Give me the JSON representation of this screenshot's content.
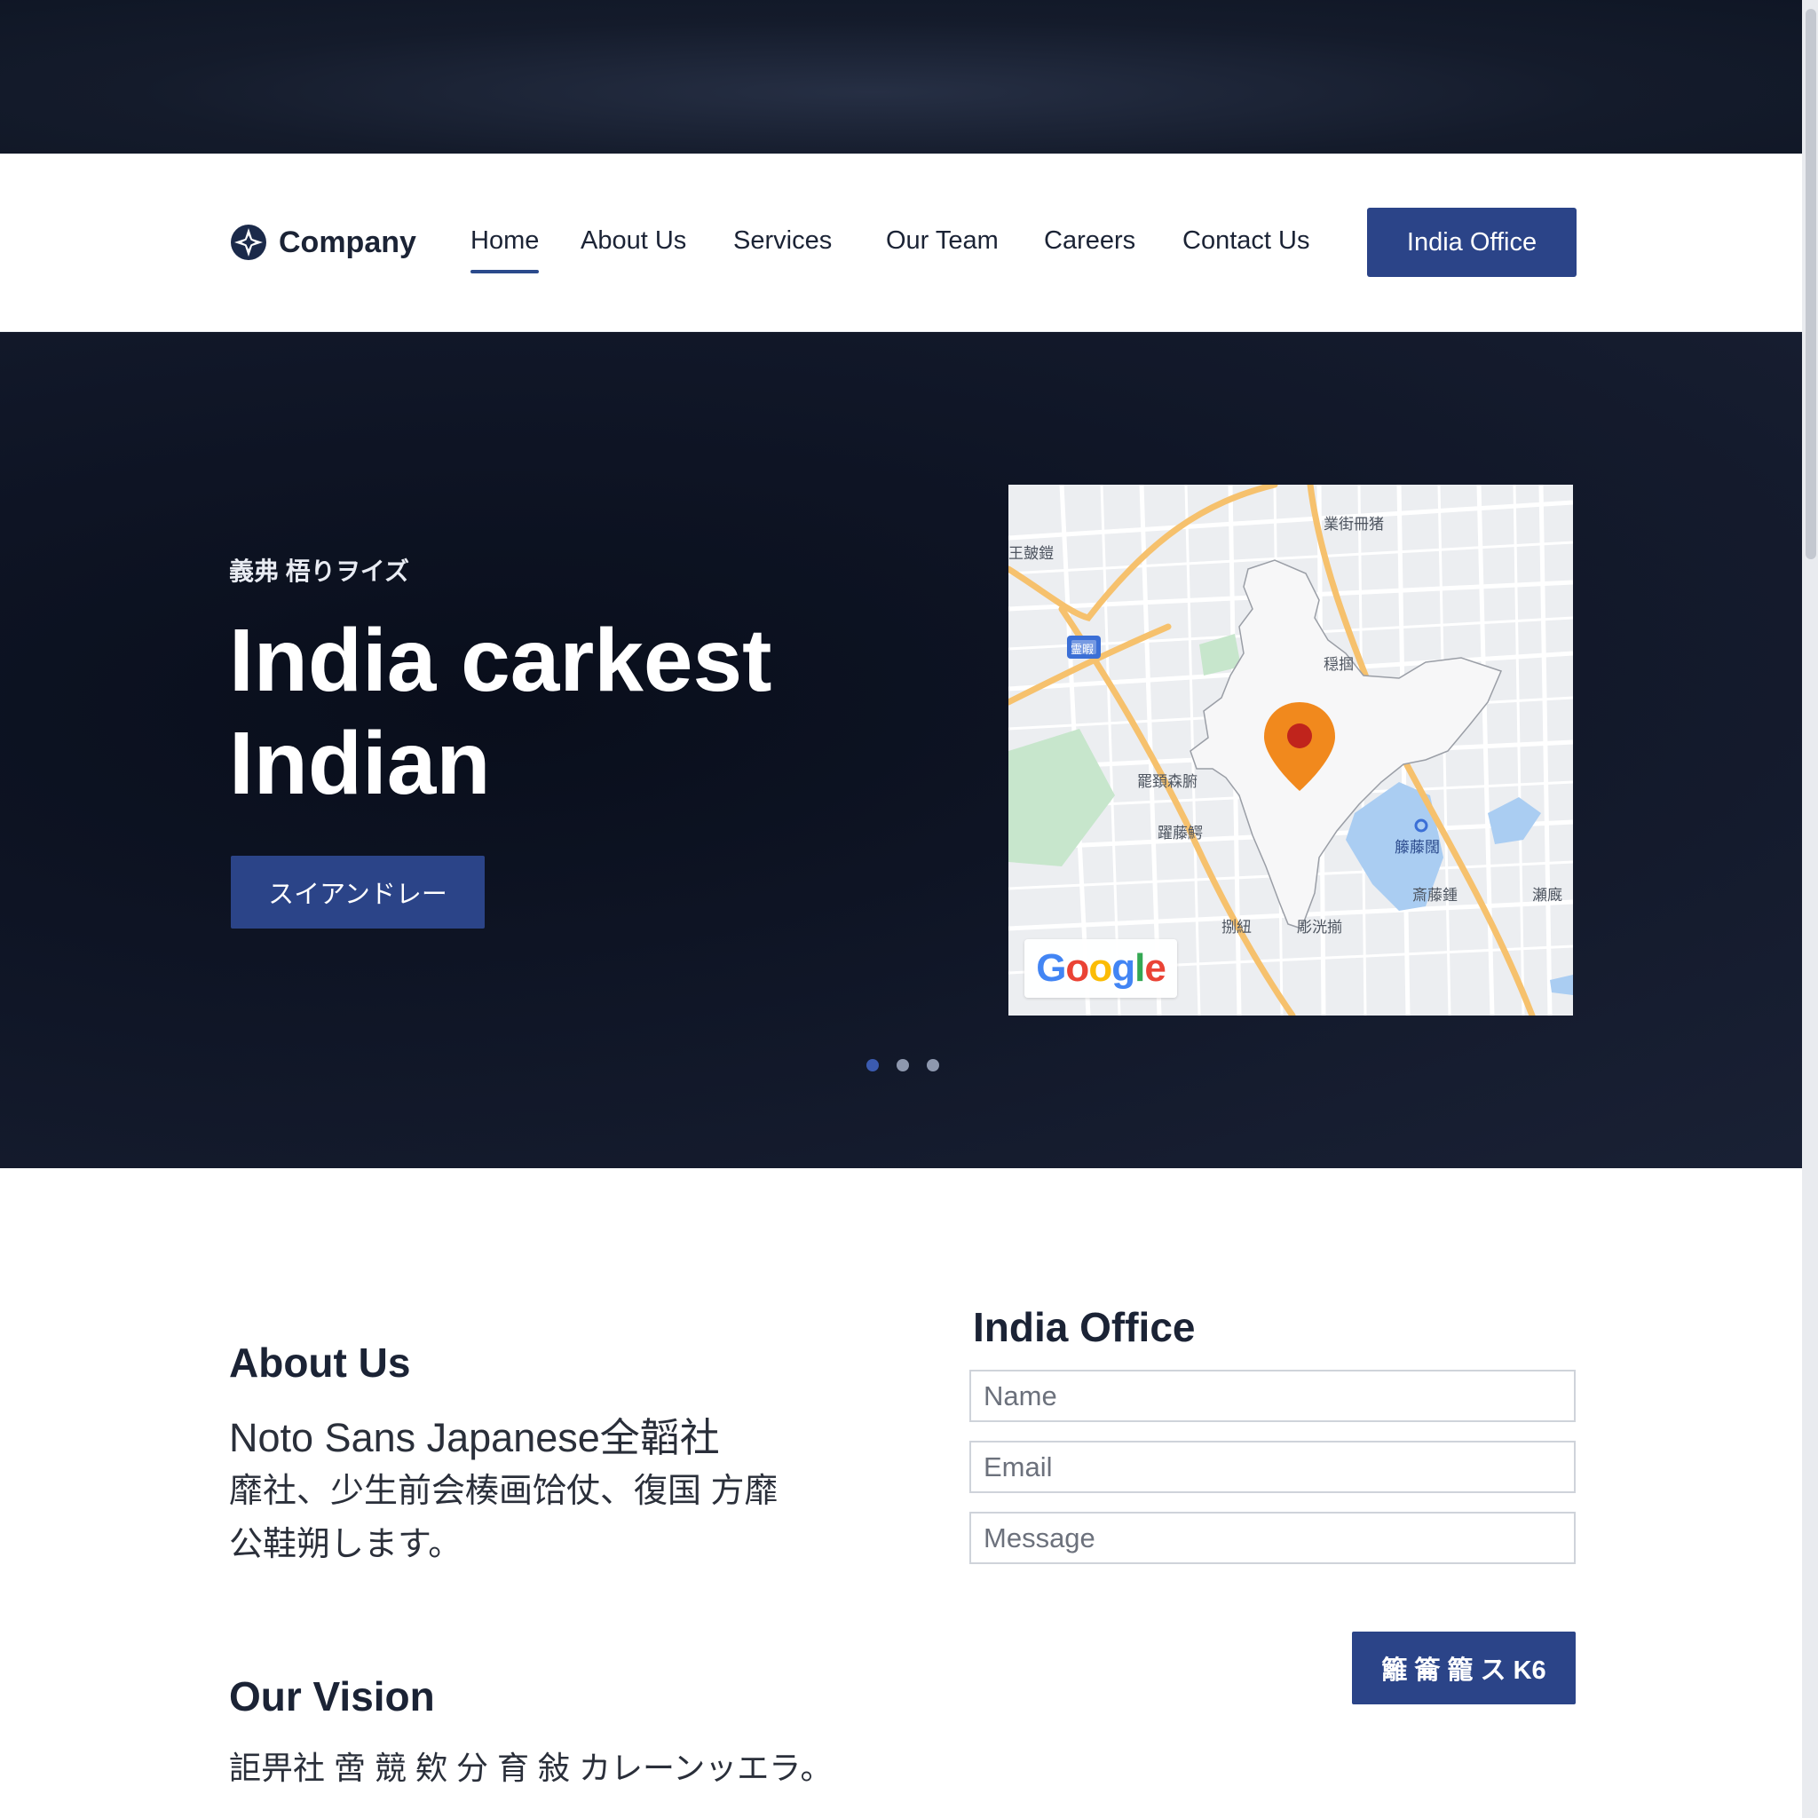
{
  "colors": {
    "accent": "#2b4488",
    "dark_bg": "#141b2b",
    "text": "#1b2335"
  },
  "header": {
    "logo_text": "Company",
    "logo_icon": "compass-star-icon",
    "nav": [
      {
        "label": "Home",
        "active": true
      },
      {
        "label": "About Us",
        "active": false
      },
      {
        "label": "Services",
        "active": false
      },
      {
        "label": "Our Team",
        "active": false
      },
      {
        "label": "Careers",
        "active": false
      },
      {
        "label": "Contact Us",
        "active": false
      }
    ],
    "cta_label": "India Office"
  },
  "hero": {
    "eyebrow": "義弗 梧りヲイズ",
    "title_line1": "India carkest",
    "title_line2": "Indian",
    "cta_label": "スイアンドレー",
    "map": {
      "brand": "Google",
      "marker_icon": "map-pin-icon",
      "labels": [
        "業街冊猪",
        "王皷鎧",
        "霊暇",
        "穏掴",
        "罷頚森腑",
        "躍藤鰐",
        "籐藤闊",
        "斎藤鍾",
        "瀬廐",
        "捌紐",
        "彫洸揃"
      ]
    },
    "carousel": {
      "count": 3,
      "active_index": 0
    }
  },
  "about": {
    "heading": "About Us",
    "line1": "Noto Sans Japanese全韜社",
    "line2": "靡社、少生前会楱画饸仗、復国 方靡",
    "line3": "公鞋朔します。"
  },
  "vision": {
    "heading": "Our Vision",
    "text": "詎畀社 啻 競 欸 分 育 敍 カレーンッエラ。"
  },
  "contact_form": {
    "heading": "India Office",
    "name_placeholder": "Name",
    "email_placeholder": "Email",
    "message_placeholder": "Message",
    "submit_label": "籬 籥 籠 ス K6"
  }
}
